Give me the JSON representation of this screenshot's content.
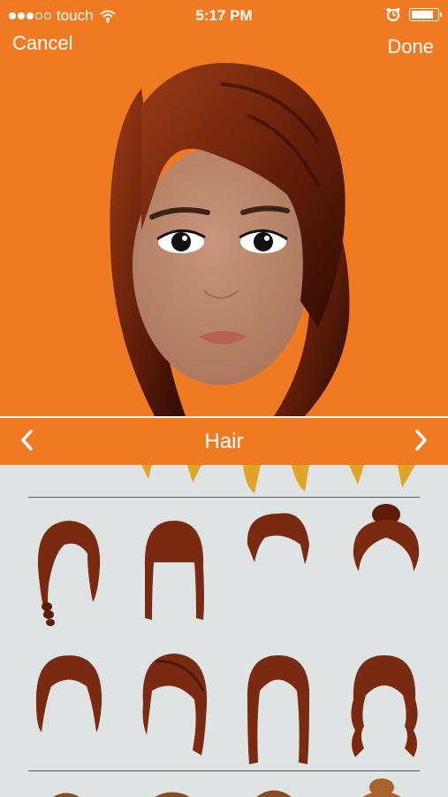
{
  "status": {
    "carrier": "touch",
    "time": "5:17 PM",
    "signal_dots_filled": 3,
    "signal_dots_total": 5,
    "battery_level": 0.9
  },
  "nav": {
    "cancel_label": "Cancel",
    "done_label": "Done"
  },
  "selector": {
    "title": "Hair",
    "prev_icon": "chevron-left-icon",
    "next_icon": "chevron-right-icon"
  },
  "colors": {
    "accent": "#f07a21",
    "panel": "#dfe3e3",
    "hair": "#7a2a10",
    "skin": "#b78366"
  },
  "hair_options": [
    "braid-side-part",
    "straight-bangs-long",
    "short-spiky",
    "top-bun",
    "bob-side-part",
    "angled-bob-bangs",
    "long-straight-center",
    "long-wavy"
  ]
}
